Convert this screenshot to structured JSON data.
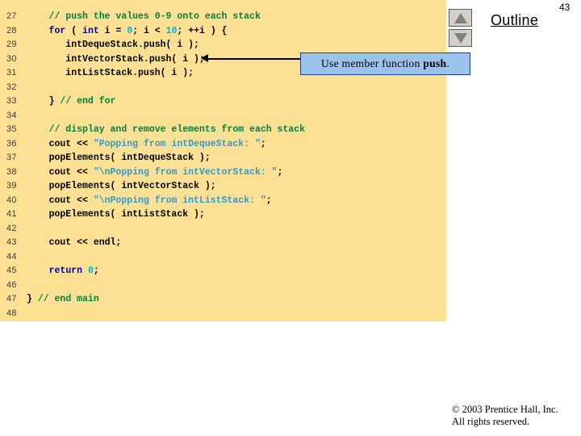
{
  "page_number": "43",
  "outline": {
    "label": "Outline"
  },
  "nav": {
    "up_icon": "triangle-up-icon",
    "down_icon": "triangle-down-icon"
  },
  "callout": {
    "text_prefix": "Use member function ",
    "text_bold": "push",
    "text_suffix": ".",
    "border_color": "#1f3f8f",
    "fill_color": "#9cc3eb"
  },
  "footer": {
    "line1": "© 2003 Prentice Hall, Inc.",
    "line2": "All rights reserved."
  },
  "code_panel": {
    "background_color": "#fce195",
    "comment_color": "#008040",
    "keyword_color": "#00008b",
    "number_color": "#00b2d6",
    "string_color": "#3399cc",
    "lines": [
      {
        "num": "27",
        "tokens": [
          {
            "t": "    // push the values 0-9 onto each stack",
            "c": "comment"
          }
        ]
      },
      {
        "num": "28",
        "tokens": [
          {
            "t": "    ",
            "c": "plain"
          },
          {
            "t": "for",
            "c": "kw"
          },
          {
            "t": " ( ",
            "c": "plain"
          },
          {
            "t": "int",
            "c": "kw"
          },
          {
            "t": " i = ",
            "c": "plain"
          },
          {
            "t": "0",
            "c": "num"
          },
          {
            "t": "; i < ",
            "c": "plain"
          },
          {
            "t": "10",
            "c": "num"
          },
          {
            "t": "; ++i ) {",
            "c": "plain"
          }
        ]
      },
      {
        "num": "29",
        "tokens": [
          {
            "t": "       intDequeStack.push( i );",
            "c": "plain"
          }
        ]
      },
      {
        "num": "30",
        "tokens": [
          {
            "t": "       intVectorStack.push( i );",
            "c": "plain"
          }
        ]
      },
      {
        "num": "31",
        "tokens": [
          {
            "t": "       intListStack.push( i );",
            "c": "plain"
          }
        ]
      },
      {
        "num": "32",
        "tokens": [
          {
            "t": "",
            "c": "plain"
          }
        ]
      },
      {
        "num": "33",
        "tokens": [
          {
            "t": "    } ",
            "c": "plain"
          },
          {
            "t": "// end for",
            "c": "comment"
          }
        ]
      },
      {
        "num": "34",
        "tokens": [
          {
            "t": "",
            "c": "plain"
          }
        ]
      },
      {
        "num": "35",
        "tokens": [
          {
            "t": "    // display and remove elements from each stack",
            "c": "comment"
          }
        ]
      },
      {
        "num": "36",
        "tokens": [
          {
            "t": "    cout << ",
            "c": "plain"
          },
          {
            "t": "\"Popping from intDequeStack: \"",
            "c": "str"
          },
          {
            "t": ";",
            "c": "plain"
          }
        ]
      },
      {
        "num": "37",
        "tokens": [
          {
            "t": "    popElements( intDequeStack );",
            "c": "plain"
          }
        ]
      },
      {
        "num": "38",
        "tokens": [
          {
            "t": "    cout << ",
            "c": "plain"
          },
          {
            "t": "\"\\nPopping from intVectorStack: \"",
            "c": "str"
          },
          {
            "t": ";",
            "c": "plain"
          }
        ]
      },
      {
        "num": "39",
        "tokens": [
          {
            "t": "    popElements( intVectorStack );",
            "c": "plain"
          }
        ]
      },
      {
        "num": "40",
        "tokens": [
          {
            "t": "    cout << ",
            "c": "plain"
          },
          {
            "t": "\"\\nPopping from intListStack: \"",
            "c": "str"
          },
          {
            "t": ";",
            "c": "plain"
          }
        ]
      },
      {
        "num": "41",
        "tokens": [
          {
            "t": "    popElements( intListStack );",
            "c": "plain"
          }
        ]
      },
      {
        "num": "42",
        "tokens": [
          {
            "t": "",
            "c": "plain"
          }
        ]
      },
      {
        "num": "43",
        "tokens": [
          {
            "t": "    cout << endl;",
            "c": "plain"
          }
        ]
      },
      {
        "num": "44",
        "tokens": [
          {
            "t": "",
            "c": "plain"
          }
        ]
      },
      {
        "num": "45",
        "tokens": [
          {
            "t": "    ",
            "c": "plain"
          },
          {
            "t": "return",
            "c": "kw"
          },
          {
            "t": " ",
            "c": "plain"
          },
          {
            "t": "0",
            "c": "num"
          },
          {
            "t": ";",
            "c": "plain"
          }
        ]
      },
      {
        "num": "46",
        "tokens": [
          {
            "t": "",
            "c": "plain"
          }
        ]
      },
      {
        "num": "47",
        "tokens": [
          {
            "t": "} ",
            "c": "plain"
          },
          {
            "t": "// end main",
            "c": "comment"
          }
        ]
      },
      {
        "num": "48",
        "tokens": [
          {
            "t": "",
            "c": "plain"
          }
        ]
      }
    ]
  }
}
